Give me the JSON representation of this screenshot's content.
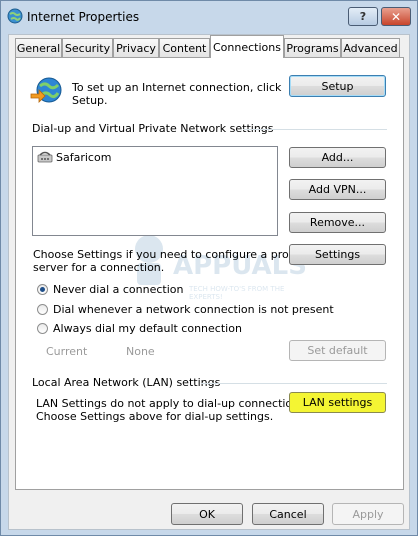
{
  "window": {
    "title": "Internet Properties",
    "help_glyph": "?",
    "close_glyph": "✕"
  },
  "tabs": [
    "General",
    "Security",
    "Privacy",
    "Content",
    "Connections",
    "Programs",
    "Advanced"
  ],
  "active_tab": "Connections",
  "setup": {
    "text_line1": "To set up an Internet connection, click",
    "text_line2": "Setup.",
    "button": "Setup"
  },
  "dialup": {
    "group_label": "Dial-up and Virtual Private Network settings",
    "connections": [
      "Safaricom"
    ],
    "add_button": "Add...",
    "add_vpn_button": "Add VPN...",
    "remove_button": "Remove...",
    "settings_text_line1": "Choose Settings if you need to configure a proxy",
    "settings_text_line2": "server for a connection.",
    "settings_button": "Settings",
    "radio_options": [
      "Never dial a connection",
      "Dial whenever a network connection is not present",
      "Always dial my default connection"
    ],
    "selected_option": "Never dial a connection",
    "current_label": "Current",
    "current_value": "None",
    "set_default_button": "Set default"
  },
  "lan": {
    "group_label": "Local Area Network (LAN) settings",
    "text_line1": "LAN Settings do not apply to dial-up connections.",
    "text_line2": "Choose Settings above for dial-up settings.",
    "button": "LAN settings",
    "highlight_color": "#f4f533"
  },
  "footer": {
    "ok": "OK",
    "cancel": "Cancel",
    "apply": "Apply"
  },
  "watermark": {
    "text": "APPUALS",
    "subtext": "TECH HOW-TO'S FROM THE EXPERTS!"
  }
}
